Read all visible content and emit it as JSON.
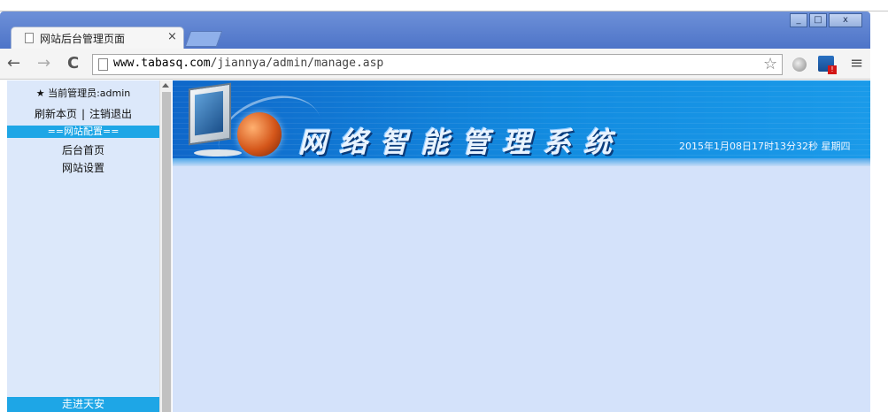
{
  "browser": {
    "tab_title": "网站后台管理页面",
    "tab_close": "×",
    "url_domain": "www.tabasq.com",
    "url_path": "/jiannya/admin/manage.asp",
    "window_minimize": "_",
    "window_maximize": "□",
    "window_close": "x",
    "nav_back": "←",
    "nav_forward": "→",
    "nav_reload": "C",
    "star": "☆",
    "menu": "≡"
  },
  "sidebar": {
    "admin_text": "★ 当前管理员:admin",
    "refresh_link": "刷新本页",
    "separator": "|",
    "logout_link": "注销退出",
    "section_header": "==网站配置==",
    "items": [
      {
        "label": "后台首页"
      },
      {
        "label": "网站设置"
      }
    ],
    "bottom_link": "走进天安"
  },
  "banner": {
    "title": "网络智能管理系统",
    "datetime": "2015年1月08日17时13分32秒 星期四"
  },
  "colors": {
    "sidebar_bg": "#dce8fa",
    "accent": "#1ea6e6",
    "main_bg": "#d4e2fa",
    "titlebar": "#5b80d0"
  }
}
